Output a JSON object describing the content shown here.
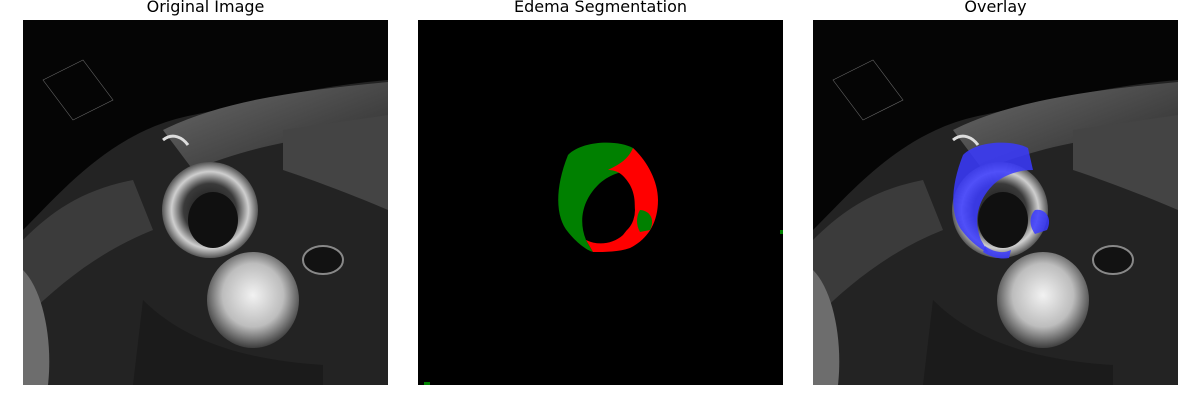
{
  "panels": [
    {
      "title": "Original Image"
    },
    {
      "title": "Edema Segmentation"
    },
    {
      "title": "Overlay"
    }
  ],
  "colors": {
    "edema_remote": "#008000",
    "edema_core": "#ff0000",
    "overlay": "#3a3aff",
    "background": "#000000"
  }
}
